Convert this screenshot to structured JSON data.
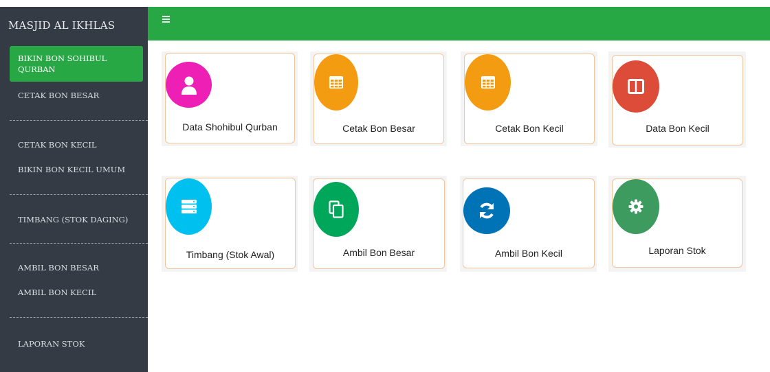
{
  "sidebar": {
    "brand": "MASJID AL IKHLAS",
    "items": [
      {
        "label": "BIKIN BON SOHIBUL QURBAN"
      },
      {
        "label": "CETAK BON BESAR"
      },
      {
        "label": "CETAK BON KECIL"
      },
      {
        "label": "BIKIN BON KECIL UMUM"
      },
      {
        "label": "TIMBANG (STOK DAGING)"
      },
      {
        "label": "AMBIL BON BESAR"
      },
      {
        "label": "AMBIL BON KECIL"
      },
      {
        "label": "LAPORAN STOK"
      }
    ],
    "active_index": 0
  },
  "topbar": {
    "menu_icon": "hamburger-icon"
  },
  "colors": {
    "sidebar_bg": "#353b45",
    "accent_green": "#28a745",
    "tile_border": "#f2c59a",
    "magenta": "#ee1fb5",
    "orange": "#f39c12",
    "red": "#dd4b39",
    "cyan": "#00c0ef",
    "green": "#00a65a",
    "blue": "#0073b7",
    "teal_green": "#3d9b5f"
  },
  "tiles": [
    {
      "label": "Data Shohibul Qurban",
      "icon": "user-icon",
      "color": "#ee1fb5"
    },
    {
      "label": "Cetak Bon Besar",
      "icon": "table-icon",
      "color": "#f39c12"
    },
    {
      "label": "Cetak Bon Kecil",
      "icon": "table-icon",
      "color": "#f39c12"
    },
    {
      "label": "Data Bon Kecil",
      "icon": "columns-icon",
      "color": "#dd4b39"
    },
    {
      "label": "Timbang (Stok Awal)",
      "icon": "server-icon",
      "color": "#00c0ef"
    },
    {
      "label": "Ambil Bon Besar",
      "icon": "copy-icon",
      "color": "#00a65a"
    },
    {
      "label": "Ambil Bon Kecil",
      "icon": "refresh-icon",
      "color": "#0073b7"
    },
    {
      "label": "Laporan Stok",
      "icon": "gear-icon",
      "color": "#3d9b5f"
    }
  ]
}
